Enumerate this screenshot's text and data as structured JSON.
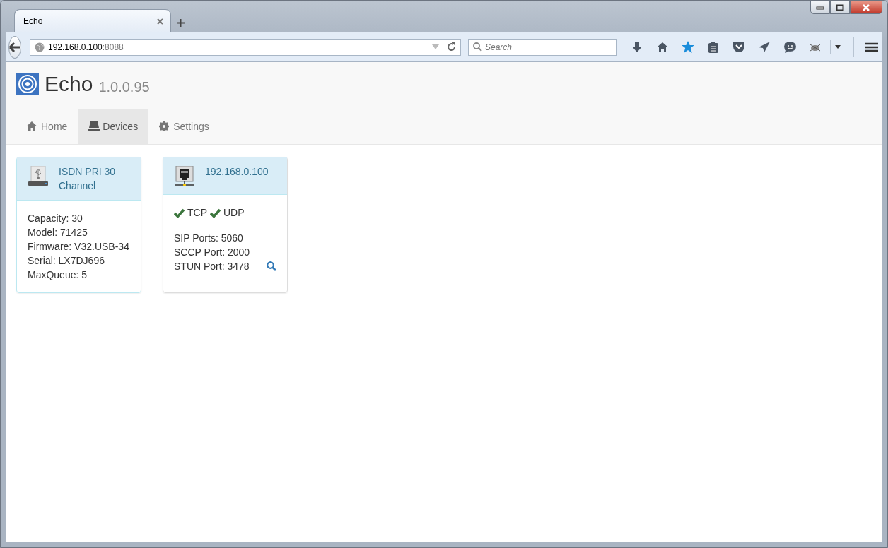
{
  "browser": {
    "tab_title": "Echo",
    "url_host": "192.168.0.100",
    "url_port": ":8088",
    "search": {
      "placeholder": "Search"
    }
  },
  "app": {
    "title": "Echo",
    "version": "1.0.0.95",
    "nav": [
      {
        "label": "Home",
        "selected": false
      },
      {
        "label": "Devices",
        "selected": true
      },
      {
        "label": "Settings",
        "selected": false
      }
    ]
  },
  "devices": [
    {
      "kind": "usb",
      "title": "ISDN PRI 30 Channel",
      "selected": true,
      "lines": [
        "Capacity: 30",
        "Model: 71425",
        "Firmware: V32.USB-34",
        "Serial: LX7DJ696",
        "MaxQueue: 5"
      ]
    },
    {
      "kind": "network",
      "title": "192.168.0.100",
      "selected": false,
      "protocols": [
        {
          "label": "TCP",
          "ok": true
        },
        {
          "label": "UDP",
          "ok": true
        }
      ],
      "lines": [
        "SIP Ports: 5060",
        "SCCP Port: 2000",
        "STUN Port: 3478"
      ]
    }
  ]
}
